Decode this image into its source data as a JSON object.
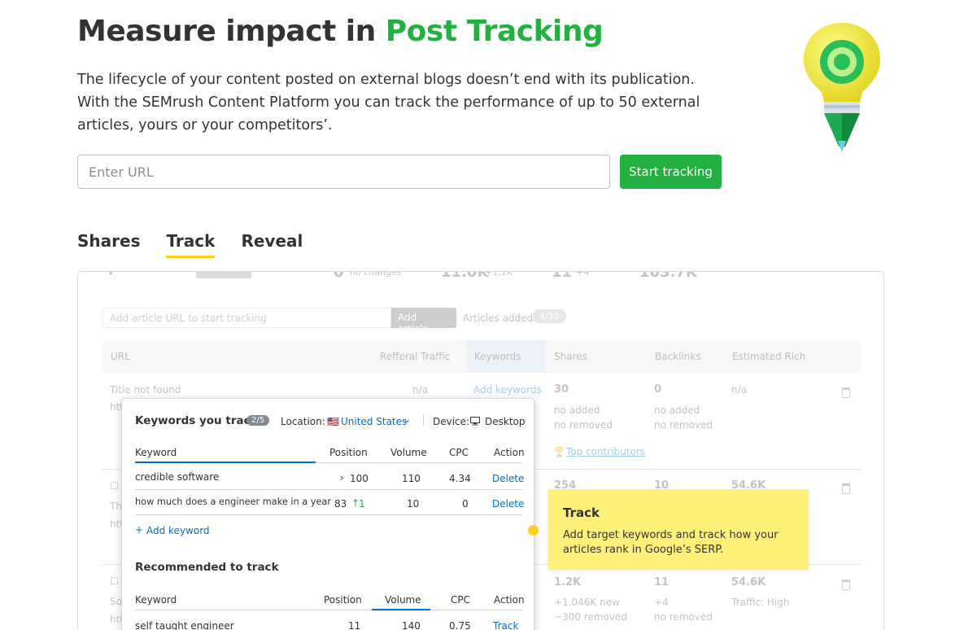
{
  "hero": {
    "title_prefix": "Measure impact in ",
    "title_accent": "Post Tracking",
    "description": "The lifecycle of your content posted on external blogs doesn’t end with its publication. With the SEMrush Content Platform you can track the performance of up to 50 external articles, yours or your competitors’.",
    "url_placeholder": "Enter URL",
    "start_button": "Start tracking"
  },
  "tabs": [
    {
      "label": "Shares",
      "active": false
    },
    {
      "label": "Track",
      "active": true
    },
    {
      "label": "Reveal",
      "active": false
    }
  ],
  "preview": {
    "top_strip": [
      "0",
      "no changes",
      "11.0K",
      "+1.1K",
      "11",
      "+4",
      "103.7K"
    ],
    "add_placeholder": "Add article URL to start tracking",
    "add_button": "Add article",
    "articles_added_label": "Articles added:",
    "articles_added_count": "4/50",
    "columns": [
      "URL",
      "Refferal Traffic",
      "Keywords",
      "Shares",
      "Backlinks",
      "Estimated Rich"
    ],
    "row1": {
      "title": "Title not found",
      "url_prefix": "htt",
      "traffic": "n/a",
      "keywords_link": "Add keywords",
      "shares": "30",
      "shares_sub1": "no added",
      "shares_sub2": "no removed",
      "backlinks": "0",
      "backlinks_sub1": "no added",
      "backlinks_sub2": "no removed",
      "rich": "n/a",
      "top_contributors": "Top contributors"
    },
    "row2": {
      "title_prefix": "Th",
      "url_prefix": "htt",
      "shares": "254",
      "backlinks": "10",
      "rich": "54.6K"
    },
    "row3": {
      "title_prefix": "So",
      "url_prefix": "htt",
      "shares": "1.2K",
      "shares_sub1": "+1.046K new",
      "shares_sub2": "−300 removed",
      "backlinks": "11",
      "backlinks_sub1": "+4",
      "backlinks_sub2": "no removed",
      "rich": "54.6K",
      "rich_sub": "Traffic: High"
    }
  },
  "popup": {
    "title": "Keywords you track",
    "count_badge": "2/5",
    "location_label": "Location:",
    "location_value": "United States",
    "device_label": "Device:",
    "device_value": "Desktop",
    "tracked_headers": [
      "Keyword",
      "Position",
      "Volume",
      "CPC",
      "Action"
    ],
    "tracked_rows": [
      {
        "keyword": "credible software",
        "position": "100",
        "volume": "110",
        "cpc": "4.34",
        "action": "Delete"
      },
      {
        "keyword": "how much does a engineer make in a year",
        "position": "83",
        "change": "1",
        "volume": "10",
        "cpc": "0",
        "action": "Delete"
      }
    ],
    "add_keyword": "Add keyword",
    "recommended_title": "Recommended to track",
    "recommended_headers": [
      "Keyword",
      "Position",
      "Volume",
      "CPC",
      "Action"
    ],
    "recommended_rows": [
      {
        "keyword": "self taught engineer",
        "position": "11",
        "volume": "140",
        "cpc": "0.75",
        "action": "Track"
      }
    ]
  },
  "tooltip": {
    "title": "Track",
    "body": "Add target keywords and track how your articles rank in Google’s SERP."
  },
  "colors": {
    "accent_green": "#22b140",
    "tab_underline": "#ffce1f",
    "tooltip_bg": "#fff07a",
    "link_blue": "#006dca"
  }
}
